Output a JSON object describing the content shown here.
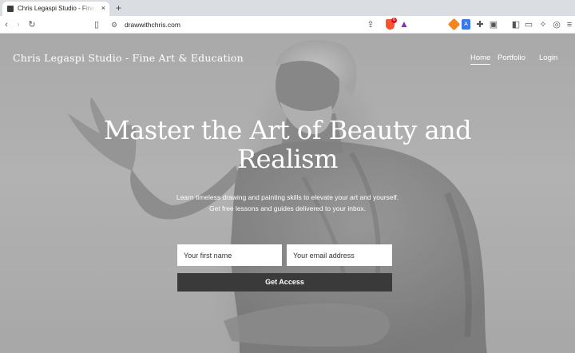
{
  "browser": {
    "tab_title": "Chris Legaspi Studio - Fine Art",
    "tab_close": "×",
    "new_tab": "+",
    "url": "drawwithchris.com",
    "brave_badge": "6"
  },
  "site": {
    "title": "Chris Legaspi Studio - Fine Art & Education",
    "nav": {
      "home": "Home",
      "portfolio": "Portfolio",
      "login": "Login"
    }
  },
  "hero": {
    "headline": "Master the Art of Beauty and Realism",
    "subtext_line1": "Learn timeless drawing and painting skills to elevate your art and yourself.",
    "subtext_line2": "Get free lessons and guides delivered to your inbox."
  },
  "form": {
    "first_name_placeholder": "Your first name",
    "email_placeholder": "Your email address",
    "submit_label": "Get Access"
  }
}
